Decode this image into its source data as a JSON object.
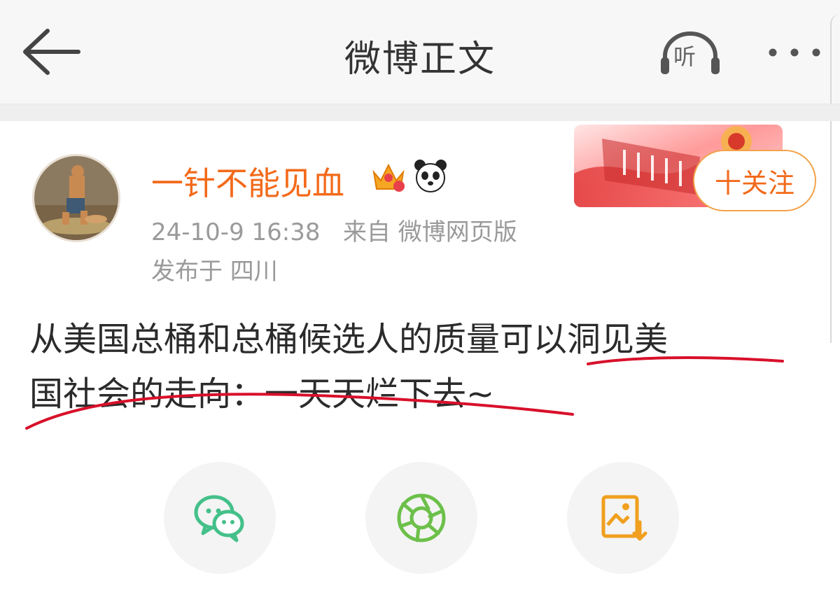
{
  "header": {
    "title": "微博正文",
    "listen_label": "听"
  },
  "post": {
    "author": "一针不能见血",
    "time": "24-10-9 16:38",
    "source": "来自 微博网页版",
    "location": "发布于 四川",
    "follow_label": "十关注",
    "text_line1": "从美国总桶和总桶候选人的质量可以洞见美",
    "text_line2": "国社会的走向：一天天烂下去~"
  },
  "colors": {
    "accent": "#f36a1a",
    "annotation": "#d8102a",
    "wechat": "#44c08a",
    "moments": "#6cc04a",
    "save": "#f0a01e"
  },
  "icons": {
    "back": "back-arrow-icon",
    "listen": "headphones-icon",
    "more": "more-dots-icon",
    "crown": "crown-icon",
    "panda": "panda-icon",
    "share_wechat": "wechat-icon",
    "share_moments": "moments-icon",
    "save_image": "save-image-icon"
  }
}
